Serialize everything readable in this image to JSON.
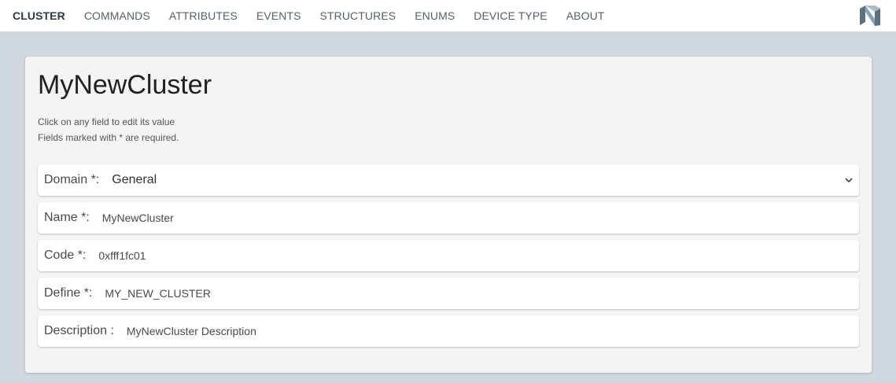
{
  "nav": {
    "tabs": [
      {
        "label": "CLUSTER",
        "active": true
      },
      {
        "label": "COMMANDS",
        "active": false
      },
      {
        "label": "ATTRIBUTES",
        "active": false
      },
      {
        "label": "EVENTS",
        "active": false
      },
      {
        "label": "STRUCTURES",
        "active": false
      },
      {
        "label": "ENUMS",
        "active": false
      },
      {
        "label": "DEVICE TYPE",
        "active": false
      },
      {
        "label": "ABOUT",
        "active": false
      }
    ],
    "logo_icon": "nordic-logo-icon"
  },
  "page": {
    "title": "MyNewCluster",
    "hint_edit": "Click on any field to edit its value",
    "hint_required": "Fields marked with * are required."
  },
  "fields": {
    "domain": {
      "label": "Domain *:",
      "value": "General"
    },
    "name": {
      "label": "Name *:",
      "value": "MyNewCluster"
    },
    "code": {
      "label": "Code *:",
      "value": "0xfff1fc01"
    },
    "define": {
      "label": "Define *:",
      "value": "MY_NEW_CLUSTER"
    },
    "description": {
      "label": "Description :",
      "value": "MyNewCluster Description"
    }
  },
  "colors": {
    "background": "#d1d9e0",
    "card": "#f4f4f4",
    "nav_active": "#2b3a45",
    "nav_text": "#555f68"
  }
}
